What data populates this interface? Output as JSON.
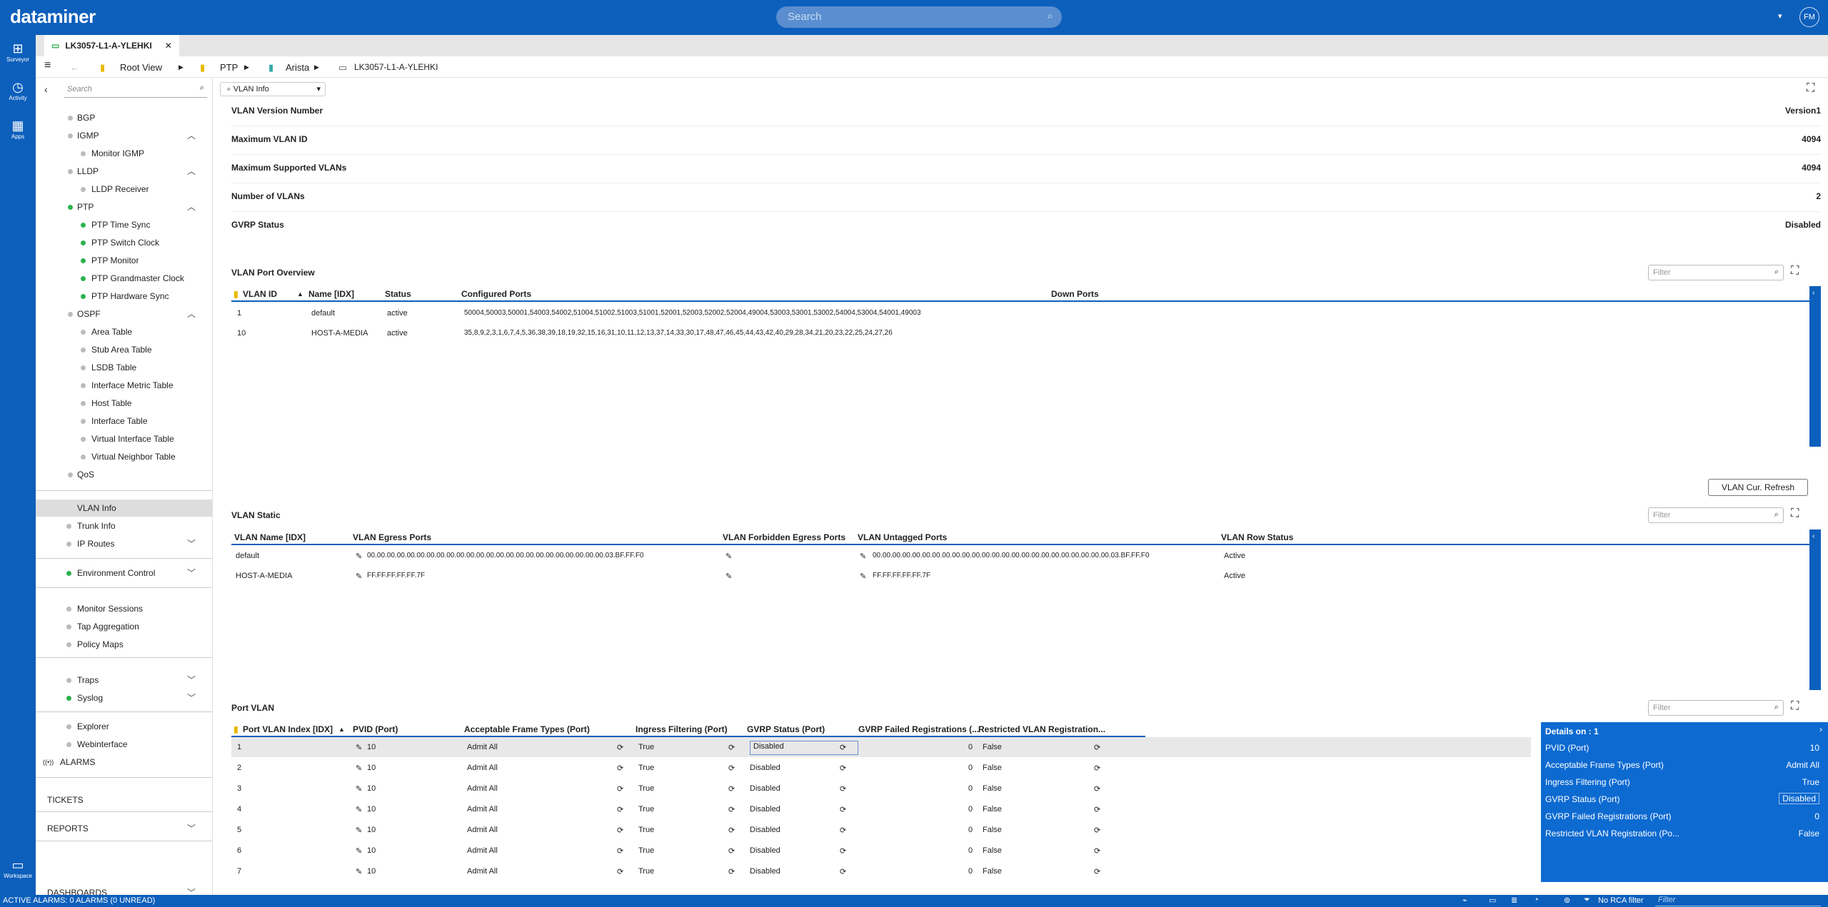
{
  "app": {
    "logo": "dataminer",
    "search_placeholder": "Search",
    "user_initials": "FM",
    "dropdown": "▾"
  },
  "rail": [
    {
      "label": "Surveyor",
      "icon": "surveyor-icon",
      "glyph": "⊞"
    },
    {
      "label": "Activity",
      "icon": "activity-icon",
      "glyph": "◷"
    },
    {
      "label": "Apps",
      "icon": "apps-icon",
      "glyph": "▦"
    },
    {
      "label": "Workspace",
      "icon": "workspace-icon",
      "glyph": "▭"
    }
  ],
  "tab": {
    "label": "LK3057-L1-A-YLEHKI",
    "close": "✕"
  },
  "breadcrumb": {
    "root": "Root View",
    "b1": "PTP",
    "b2": "Arista",
    "b3": "LK3057-L1-A-YLEHKI"
  },
  "sidebar": {
    "search_placeholder": "Search",
    "items": [
      {
        "label": "BGP",
        "dot": "grey",
        "indent": 1
      },
      {
        "label": "IGMP",
        "dot": "grey",
        "indent": 1,
        "chev": "up"
      },
      {
        "label": "Monitor IGMP",
        "dot": "grey",
        "indent": 2
      },
      {
        "label": "LLDP",
        "dot": "grey",
        "indent": 1,
        "chev": "up"
      },
      {
        "label": "LLDP Receiver",
        "dot": "grey",
        "indent": 2
      },
      {
        "label": "PTP",
        "dot": "green",
        "indent": 1,
        "chev": "up"
      },
      {
        "label": "PTP Time Sync",
        "dot": "green",
        "indent": 2
      },
      {
        "label": "PTP Switch Clock",
        "dot": "green",
        "indent": 2
      },
      {
        "label": "PTP Monitor",
        "dot": "green",
        "indent": 2
      },
      {
        "label": "PTP Grandmaster Clock",
        "dot": "green",
        "indent": 2
      },
      {
        "label": "PTP Hardware Sync",
        "dot": "green",
        "indent": 2
      },
      {
        "label": "OSPF",
        "dot": "grey",
        "indent": 1,
        "chev": "up"
      },
      {
        "label": "Area Table",
        "dot": "grey",
        "indent": 2
      },
      {
        "label": "Stub Area Table",
        "dot": "grey",
        "indent": 2
      },
      {
        "label": "LSDB Table",
        "dot": "grey",
        "indent": 2
      },
      {
        "label": "Interface Metric Table",
        "dot": "grey",
        "indent": 2
      },
      {
        "label": "Host Table",
        "dot": "grey",
        "indent": 2
      },
      {
        "label": "Interface Table",
        "dot": "grey",
        "indent": 2
      },
      {
        "label": "Virtual Interface Table",
        "dot": "grey",
        "indent": 2
      },
      {
        "label": "Virtual Neighbor Table",
        "dot": "grey",
        "indent": 2
      },
      {
        "label": "QoS",
        "dot": "grey",
        "indent": 1
      }
    ],
    "items2": [
      {
        "label": "VLAN Info",
        "dot": "none",
        "selected": true
      },
      {
        "label": "Trunk Info",
        "dot": "grey"
      },
      {
        "label": "IP Routes",
        "dot": "grey",
        "chev": "down"
      }
    ],
    "env": {
      "label": "Environment Control",
      "chev": "down"
    },
    "group3": [
      "Monitor Sessions",
      "Tap Aggregation",
      "Policy Maps"
    ],
    "traps": "Traps",
    "syslog": "Syslog",
    "explorer": "Explorer",
    "webinterface": "Webinterface",
    "alarms": "ALARMS",
    "tickets": "TICKETS",
    "reports": "REPORTS",
    "dashboards": "DASHBOARDS"
  },
  "view_selector": "VLAN Info",
  "params": [
    {
      "k": "VLAN Version Number",
      "v": "Version1"
    },
    {
      "k": "Maximum VLAN ID",
      "v": "4094"
    },
    {
      "k": "Maximum Supported VLANs",
      "v": "4094"
    },
    {
      "k": "Number of VLANs",
      "v": "2"
    },
    {
      "k": "GVRP Status",
      "v": "Disabled"
    }
  ],
  "port_overview": {
    "title": "VLAN Port Overview",
    "filter": "Filter",
    "headers": [
      "VLAN ID",
      "Name [IDX]",
      "Status",
      "Configured Ports",
      "Down Ports"
    ],
    "rows": [
      [
        "1",
        "default",
        "active",
        "50004,50003,50001,54003,54002,51004,51002,51003,51001,52001,52003,52002,52004,49004,53003,53001,53002,54004,53004,54001,49003",
        ""
      ],
      [
        "10",
        "HOST-A-MEDIA",
        "active",
        "35,8,9,2,3,1,6,7,4,5,36,38,39,18,19,32,15,16,31,10,11,12,13,37,14,33,30,17,48,47,46,45,44,43,42,40,29,28,34,21,20,23,22,25,24,27,26",
        ""
      ]
    ]
  },
  "refresh_button": "VLAN Cur. Refresh",
  "vlan_static": {
    "title": "VLAN Static",
    "filter": "Filter",
    "headers": [
      "VLAN Name [IDX]",
      "VLAN Egress Ports",
      "VLAN Forbidden Egress Ports",
      "VLAN Untagged Ports",
      "VLAN Row Status"
    ],
    "rows": [
      [
        "default",
        "00.00.00.00.00.00.00.00.00.00.00.00.00.00.00.00.00.00.00.00.00.00.00.00.03.BF.FF.F0",
        "",
        "00.00.00.00.00.00.00.00.00.00.00.00.00.00.00.00.00.00.00.00.00.00.00.00.03.BF.FF.F0",
        "Active"
      ],
      [
        "HOST-A-MEDIA",
        "FF.FF.FF.FF.FF.7F",
        "",
        "FF.FF.FF.FF.FF.7F",
        "Active"
      ]
    ]
  },
  "port_vlan": {
    "title": "Port VLAN",
    "filter": "Filter",
    "headers": [
      "Port VLAN Index [IDX]",
      "PVID (Port)",
      "Acceptable Frame Types (Port)",
      "Ingress Filtering (Port)",
      "GVRP Status (Port)",
      "GVRP Failed Registrations (...",
      "Restricted VLAN Registration..."
    ],
    "rows": [
      [
        "1",
        "10",
        "Admit All",
        "True",
        "Disabled",
        "0",
        "False"
      ],
      [
        "2",
        "10",
        "Admit All",
        "True",
        "Disabled",
        "0",
        "False"
      ],
      [
        "3",
        "10",
        "Admit All",
        "True",
        "Disabled",
        "0",
        "False"
      ],
      [
        "4",
        "10",
        "Admit All",
        "True",
        "Disabled",
        "0",
        "False"
      ],
      [
        "5",
        "10",
        "Admit All",
        "True",
        "Disabled",
        "0",
        "False"
      ],
      [
        "6",
        "10",
        "Admit All",
        "True",
        "Disabled",
        "0",
        "False"
      ],
      [
        "7",
        "10",
        "Admit All",
        "True",
        "Disabled",
        "0",
        "False"
      ]
    ]
  },
  "details": {
    "title": "Details on : 1",
    "rows": [
      {
        "k": "PVID (Port)",
        "v": "10"
      },
      {
        "k": "Acceptable Frame Types (Port)",
        "v": "Admit All"
      },
      {
        "k": "Ingress Filtering (Port)",
        "v": "True"
      },
      {
        "k": "GVRP Status (Port)",
        "v": "Disabled"
      },
      {
        "k": "GVRP Failed Registrations (Port)",
        "v": "0"
      },
      {
        "k": "Restricted VLAN Registration (Po...",
        "v": "False"
      }
    ]
  },
  "statusbar": {
    "alarms": "ACTIVE ALARMS: 0 ALARMS (0 UNREAD)",
    "rca": "No RCA filter",
    "filter": "Filter"
  },
  "colors": {
    "brand": "#0d5fbc",
    "green": "#2bb24c"
  }
}
